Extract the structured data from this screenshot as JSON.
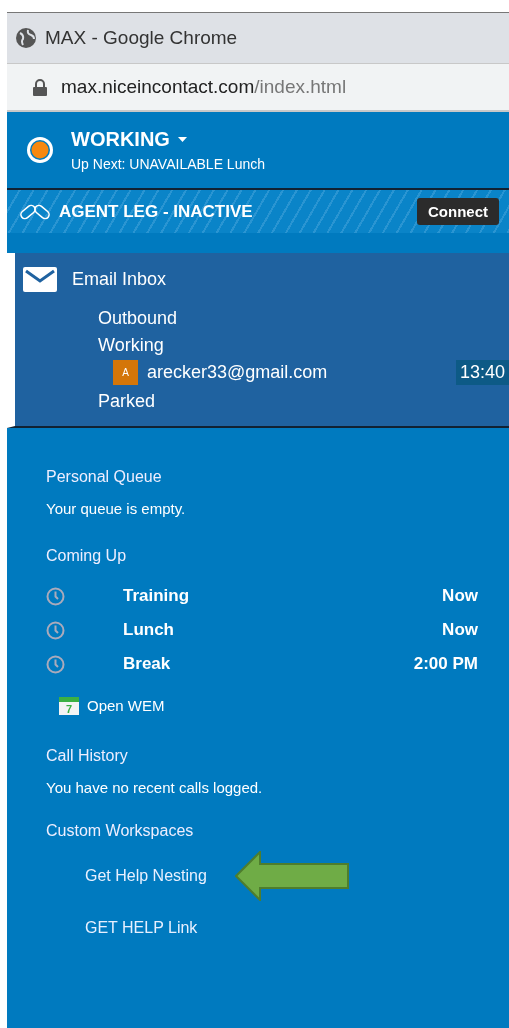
{
  "window": {
    "title": "MAX - Google Chrome"
  },
  "address_bar": {
    "host": "max.niceincontact.com",
    "path": "/index.html"
  },
  "status": {
    "label": "WORKING",
    "up_next": "Up Next: UNAVAILABLE Lunch"
  },
  "agent_leg": {
    "label": "AGENT LEG - INACTIVE",
    "button": "Connect"
  },
  "email_inbox": {
    "title": "Email Inbox",
    "folders": [
      {
        "label": "Outbound"
      },
      {
        "label": "Working",
        "children": [
          {
            "avatar": "A",
            "address": "arecker33@gmail.com",
            "timer": "13:40"
          }
        ]
      },
      {
        "label": "Parked"
      }
    ]
  },
  "personal_queue": {
    "heading": "Personal Queue",
    "message": "Your queue is empty."
  },
  "coming_up": {
    "heading": "Coming Up",
    "items": [
      {
        "name": "Training",
        "time": "Now"
      },
      {
        "name": "Lunch",
        "time": "Now"
      },
      {
        "name": "Break",
        "time": "2:00 PM"
      }
    ]
  },
  "open_wem": {
    "icon_day": "7",
    "label": "Open WEM"
  },
  "call_history": {
    "heading": "Call History",
    "message": "You have no recent calls logged."
  },
  "custom_workspaces": {
    "heading": "Custom Workspaces",
    "links": [
      "Get Help Nesting",
      "GET HELP Link"
    ]
  }
}
